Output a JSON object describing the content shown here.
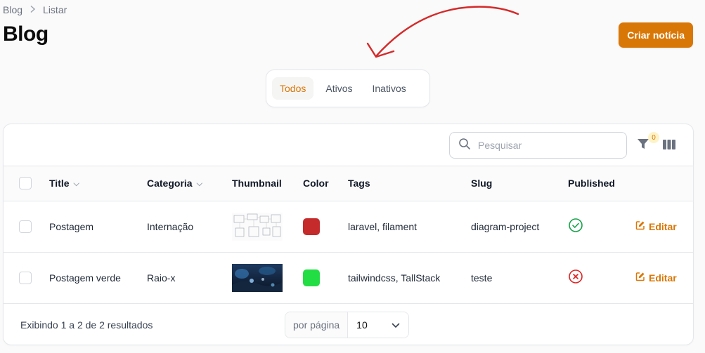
{
  "breadcrumb": {
    "root": "Blog",
    "current": "Listar"
  },
  "page": {
    "title": "Blog"
  },
  "actions": {
    "create_label": "Criar notícia"
  },
  "tabs": [
    {
      "label": "Todos",
      "active": true
    },
    {
      "label": "Ativos",
      "active": false
    },
    {
      "label": "Inativos",
      "active": false
    }
  ],
  "search": {
    "placeholder": "Pesquisar",
    "value": ""
  },
  "filters": {
    "count": "0"
  },
  "table": {
    "columns": [
      "Title",
      "Categoria",
      "Thumbnail",
      "Color",
      "Tags",
      "Slug",
      "Published"
    ],
    "rows": [
      {
        "title": "Postagem",
        "category": "Internação",
        "thumbnail": "diagram-image",
        "color": "#c52b2b",
        "tags": "laravel, filament",
        "slug": "diagram-project",
        "published": true,
        "action": "Editar"
      },
      {
        "title": "Postagem verde",
        "category": "Raio-x",
        "thumbnail": "dark-blue-photo",
        "color": "#22dd44",
        "tags": "tailwindcss, TallStack",
        "slug": "teste",
        "published": false,
        "action": "Editar"
      }
    ]
  },
  "footer": {
    "results": "Exibindo 1 a 2 de 2 resultados",
    "per_page_label": "por página",
    "per_page_value": "10"
  },
  "colors": {
    "accent": "#d97706",
    "success": "#16a34a",
    "danger": "#dc2626",
    "annotation_arrow": "#d42a2a"
  }
}
